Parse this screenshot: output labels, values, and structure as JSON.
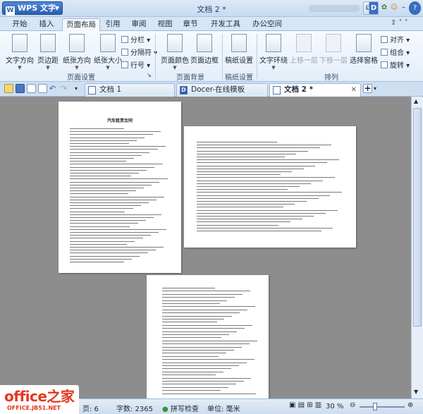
{
  "app": {
    "name": "WPS 文字",
    "title": "文档 2 *"
  },
  "menu_tabs": [
    "开始",
    "插入",
    "页面布局",
    "引用",
    "审阅",
    "视图",
    "章节",
    "开发工具",
    "办公空间"
  ],
  "active_tab": "页面布局",
  "ribbon": {
    "page_setup": {
      "group_label": "页面设置",
      "buttons": [
        "文字方向",
        "页边距",
        "纸张方向",
        "纸张大小"
      ],
      "small": [
        "分栏",
        "分隔符",
        "行号"
      ]
    },
    "page_background": {
      "group_label": "页面背景",
      "buttons": [
        "页面颜色",
        "页面边框"
      ]
    },
    "manuscript": {
      "group_label": "稿纸设置",
      "buttons": [
        "稿纸设置"
      ]
    },
    "arrange": {
      "group_label": "排列",
      "buttons": [
        "文字环绕",
        "上移一层",
        "下移一层",
        "选择窗格"
      ],
      "small": [
        "对齐",
        "组合",
        "旋转"
      ]
    }
  },
  "doc_tabs": [
    {
      "label": "文档 1",
      "active": false
    },
    {
      "label": "Docer-在线模板",
      "active": false
    },
    {
      "label": "文档 2 *",
      "active": true
    }
  ],
  "pages": {
    "title_page1": "汽车租赁合同"
  },
  "status": {
    "page": "页: 6",
    "words": "字数: 2365",
    "spellcheck": "拼写检查",
    "unit": "单位: 毫米",
    "zoom": "30 %",
    "zoom_level": 0.3
  },
  "watermark": {
    "line1": "office之家",
    "line2": "OFFICE.JB51.NET"
  },
  "colors": {
    "accent": "#2a5fb0",
    "workspace": "#8d8d8d",
    "ribbon": "#e3edf8"
  }
}
